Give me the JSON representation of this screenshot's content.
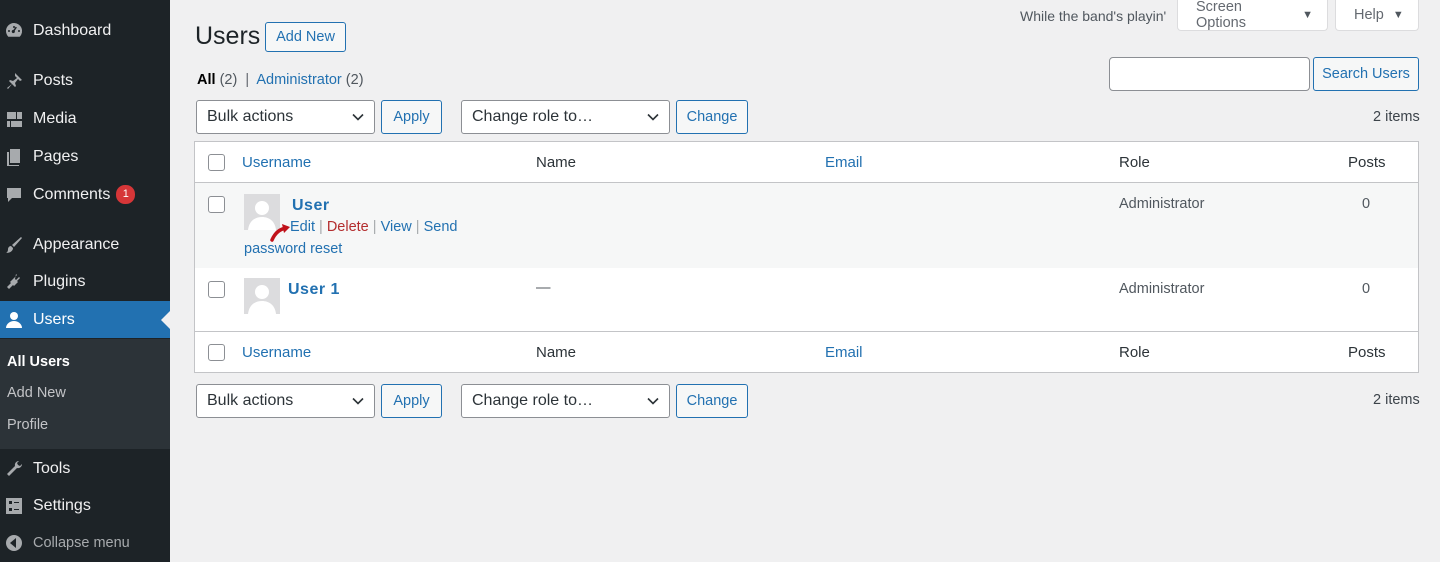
{
  "sidebar": {
    "items": [
      {
        "label": "Dashboard",
        "icon": "dashboard-icon"
      },
      {
        "label": "Posts",
        "icon": "pin-icon"
      },
      {
        "label": "Media",
        "icon": "media-icon"
      },
      {
        "label": "Pages",
        "icon": "pages-icon"
      },
      {
        "label": "Comments",
        "icon": "comments-icon",
        "badge": "1"
      },
      {
        "label": "Appearance",
        "icon": "paintbrush-icon"
      },
      {
        "label": "Plugins",
        "icon": "plugin-icon"
      },
      {
        "label": "Users",
        "icon": "user-icon",
        "active": true
      },
      {
        "label": "Tools",
        "icon": "wrench-icon"
      },
      {
        "label": "Settings",
        "icon": "settings-icon"
      }
    ],
    "submenu": [
      "All Users",
      "Add New",
      "Profile"
    ],
    "collapse_label": "Collapse menu"
  },
  "topbar": {
    "tagline": "While the band's playin'",
    "screen_options": "Screen Options",
    "help": "Help"
  },
  "page": {
    "title": "Users",
    "add_new": "Add New"
  },
  "views": {
    "all_label": "All",
    "all_count": "(2)",
    "separator": "|",
    "admin_label": "Administrator",
    "admin_count": "(2)"
  },
  "search": {
    "button": "Search Users",
    "value": ""
  },
  "bulk": {
    "select": "Bulk actions",
    "apply": "Apply",
    "role_select": "Change role to…",
    "change": "Change",
    "items_count": "2 items"
  },
  "table": {
    "columns": [
      "Username",
      "Name",
      "Email",
      "Role",
      "Posts"
    ],
    "rows": [
      {
        "username": "User",
        "name": "",
        "email": "",
        "role": "Administrator",
        "posts": "0",
        "actions": {
          "edit": "Edit",
          "delete": "Delete",
          "view": "View",
          "send": "Send",
          "reset": "password reset"
        }
      },
      {
        "username": "User 1",
        "name": "—",
        "email": "",
        "role": "Administrator",
        "posts": "0"
      }
    ]
  },
  "colors": {
    "sidebar_bg": "#1d2327",
    "accent": "#2271b1",
    "delete": "#b32d2e",
    "annotation_arrow": "#c0121a"
  }
}
